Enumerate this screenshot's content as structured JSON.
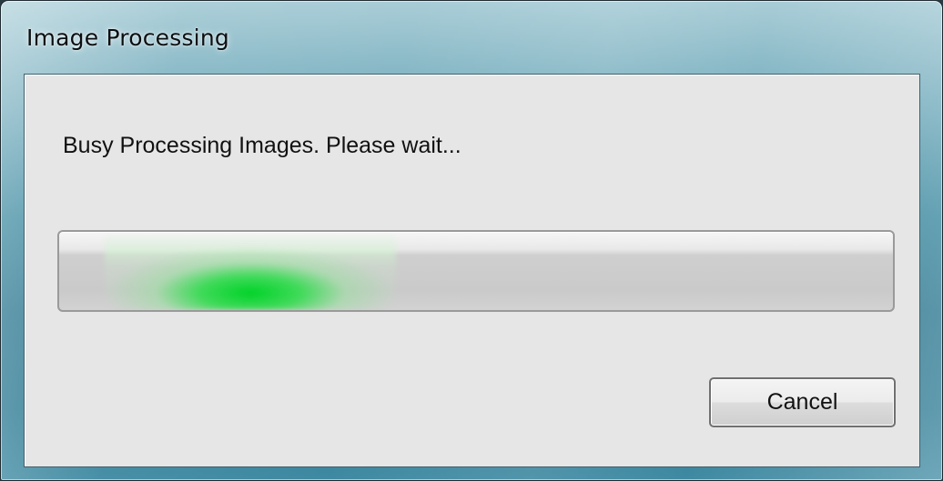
{
  "window": {
    "title": "Image Processing"
  },
  "dialog": {
    "message": "Busy Processing Images. Please wait...",
    "progress": {
      "mode": "indeterminate-marquee",
      "indicator_color": "#00d21e"
    },
    "cancel_label": "Cancel"
  }
}
